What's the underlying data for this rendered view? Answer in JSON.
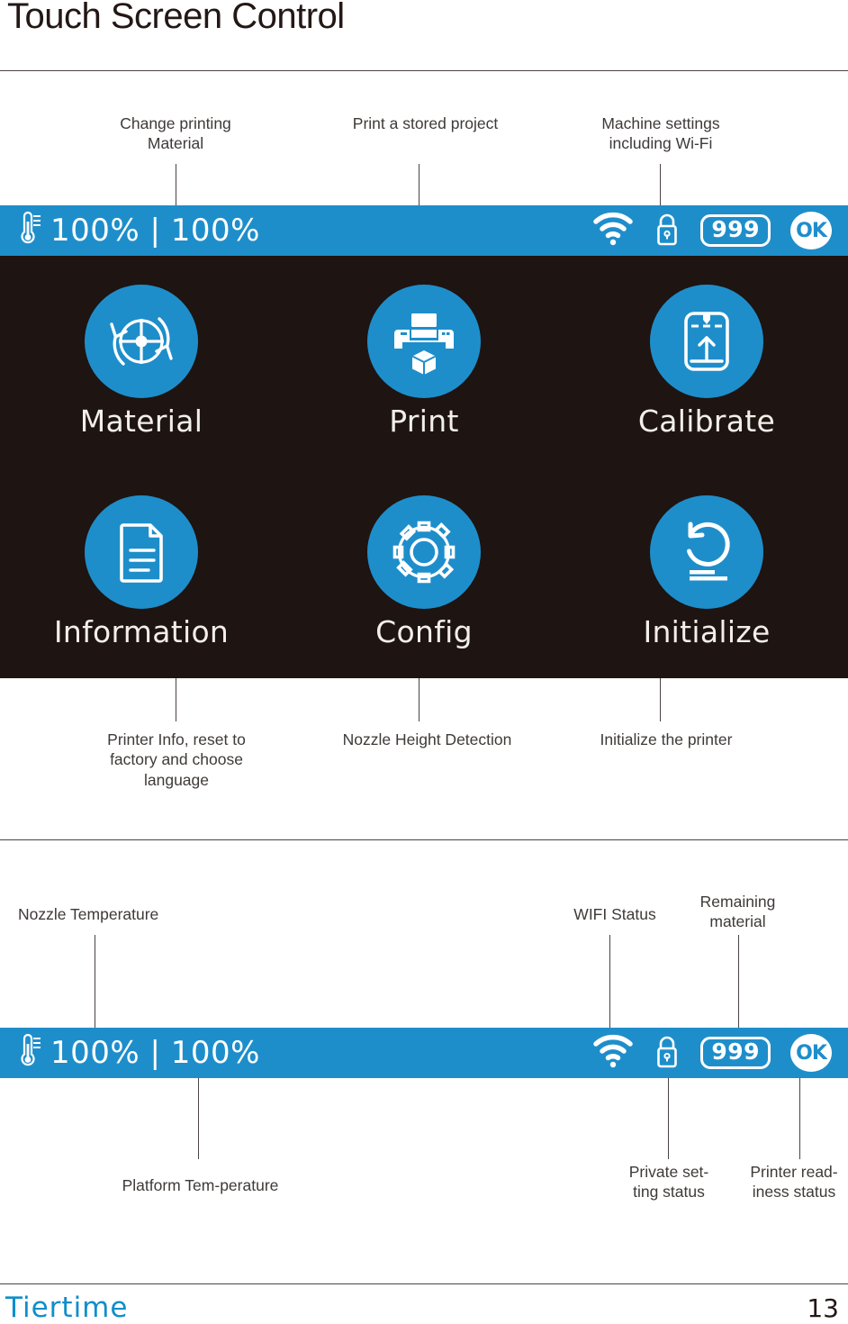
{
  "page": {
    "title": "Touch Screen Control",
    "number": "13",
    "brand": "Tiertime"
  },
  "menu_screen": {
    "status_bar": {
      "thermometer_icon": "thermometer-icon",
      "temperature": "100% | 100%",
      "wifi_icon": "wifi-icon",
      "lock_icon": "lock-icon",
      "material_badge": "999",
      "ready_badge": "OK"
    },
    "items": [
      {
        "label": "Material",
        "icon": "material-rotate-icon"
      },
      {
        "label": "Print",
        "icon": "printer-cube-icon"
      },
      {
        "label": "Calibrate",
        "icon": "calibrate-nozzle-icon"
      },
      {
        "label": "Information",
        "icon": "document-lines-icon"
      },
      {
        "label": "Config",
        "icon": "gear-icon"
      },
      {
        "label": "Initialize",
        "icon": "reset-arrow-icon"
      }
    ]
  },
  "annotations_top": [
    {
      "text": "Change printing Material"
    },
    {
      "text": "Print a stored project"
    },
    {
      "text": "Machine settings including Wi-Fi"
    }
  ],
  "annotations_bottom": [
    {
      "text": "Printer Info, reset to factory and choose language"
    },
    {
      "text": "Nozzle Height Detection"
    },
    {
      "text": "Initialize the printer"
    }
  ],
  "status_section": {
    "annotations_above": [
      {
        "text": "Nozzle Temperature"
      },
      {
        "text": "WIFI Status"
      },
      {
        "text": "Remaining material"
      }
    ],
    "annotations_below": [
      {
        "text": "Platform Tem-perature"
      },
      {
        "text": "Private set-ting status"
      },
      {
        "text": "Printer read-iness status"
      }
    ],
    "status_bar": {
      "temperature": "100% | 100%",
      "material_badge": "999",
      "ready_badge": "OK"
    }
  },
  "colors": {
    "accent_blue": "#1e8ecb",
    "screen_dark": "#1e1411",
    "text_dark": "#231815"
  }
}
